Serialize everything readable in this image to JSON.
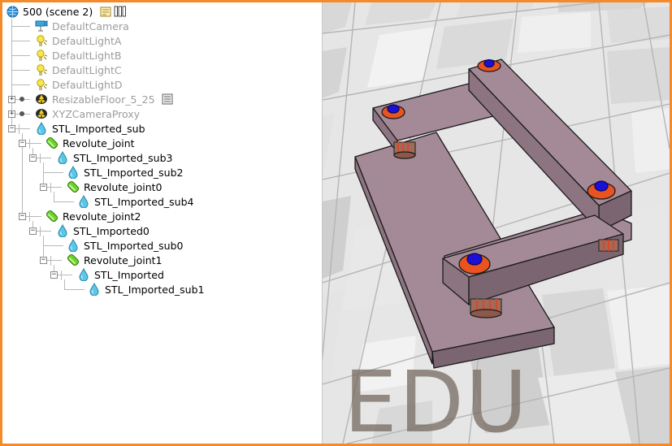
{
  "tree": {
    "root": {
      "label": "500 (scene 2)"
    },
    "nodes": [
      {
        "label": "DefaultCamera",
        "icon": "camera-icon"
      },
      {
        "label": "DefaultLightA",
        "icon": "light-icon"
      },
      {
        "label": "DefaultLightB",
        "icon": "light-icon"
      },
      {
        "label": "DefaultLightC",
        "icon": "light-icon"
      },
      {
        "label": "DefaultLightD",
        "icon": "light-icon"
      },
      {
        "label": "ResizableFloor_5_25",
        "icon": "proxy-icon"
      },
      {
        "label": "XYZCameraProxy",
        "icon": "proxy-icon"
      },
      {
        "label": "STL_Imported_sub",
        "icon": "shape-icon"
      },
      {
        "label": "Revolute_joint",
        "icon": "joint-icon"
      },
      {
        "label": "STL_Imported_sub3",
        "icon": "shape-icon"
      },
      {
        "label": "STL_Imported_sub2",
        "icon": "shape-icon"
      },
      {
        "label": "Revolute_joint0",
        "icon": "joint-icon"
      },
      {
        "label": "STL_Imported_sub4",
        "icon": "shape-icon"
      },
      {
        "label": "Revolute_joint2",
        "icon": "joint-icon"
      },
      {
        "label": "STL_Imported0",
        "icon": "shape-icon"
      },
      {
        "label": "STL_Imported_sub0",
        "icon": "shape-icon"
      },
      {
        "label": "Revolute_joint1",
        "icon": "joint-icon"
      },
      {
        "label": "STL_Imported",
        "icon": "shape-icon"
      },
      {
        "label": "STL_Imported_sub1",
        "icon": "shape-icon"
      }
    ]
  },
  "viewport": {
    "watermark": "EDU"
  },
  "colors": {
    "frame": "#f48a2a",
    "disabled_text": "#9c9c9c",
    "link_body": "#a48a96",
    "joint_ring": "#e8531f",
    "joint_pin": "#1a10d8"
  }
}
